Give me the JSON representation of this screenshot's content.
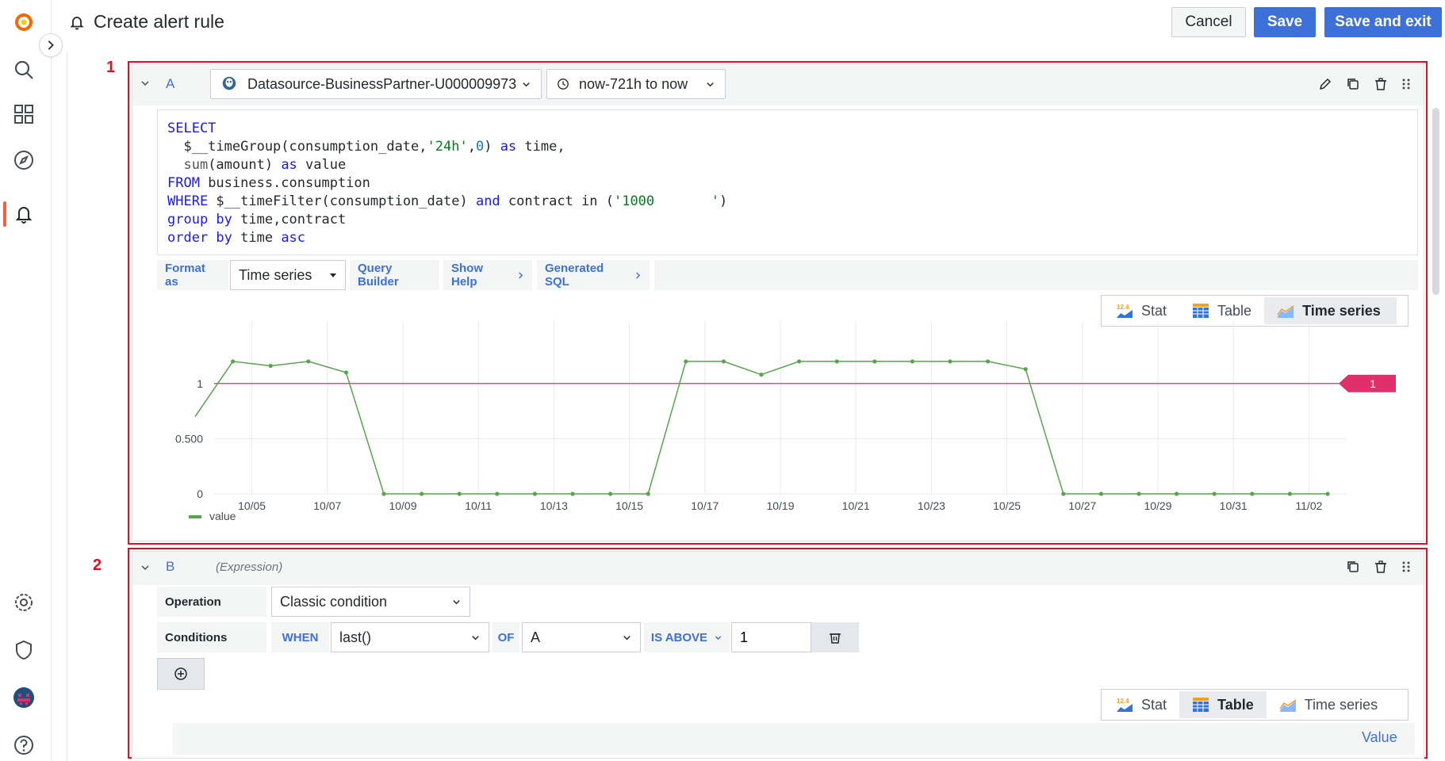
{
  "page": {
    "title": "Create alert rule"
  },
  "actions": {
    "cancel": "Cancel",
    "save": "Save",
    "save_exit": "Save and exit"
  },
  "markers": {
    "one": "1",
    "two": "2"
  },
  "query_a": {
    "ref_id": "A",
    "datasource": "Datasource-BusinessPartner-U000009973",
    "time_range": "now-721h to now",
    "sql": {
      "l1": "SELECT",
      "l2a": "  $__timeGroup(consumption_date,",
      "l2b": "'24h'",
      "l2c": ",",
      "l2d": "0",
      "l2e": ") ",
      "l2f": "as",
      "l2g": " time,",
      "l3a": "  sum",
      "l3b": "(amount) ",
      "l3c": "as",
      "l3d": " value",
      "l4a": "FROM",
      "l4b": " business.consumption",
      "l5a": "WHERE",
      "l5b": " $__timeFilter(consumption_date) ",
      "l5c": "and",
      "l5d": " contract in (",
      "l5e": "'1000       '",
      "l5f": ")",
      "l6a": "group by",
      "l6b": " time,contract",
      "l7a": "order by",
      "l7b": " time ",
      "l7c": "asc"
    },
    "toolbar": {
      "format_as_label": "Format as",
      "format_value": "Time series",
      "query_builder": "Query Builder",
      "show_help": "Show Help",
      "generated_sql": "Generated SQL"
    },
    "viz": {
      "stat": "Stat",
      "table": "Table",
      "time_series": "Time series",
      "selected": "Time series"
    }
  },
  "chart_data": {
    "type": "line",
    "title": "",
    "xlabel": "",
    "ylabel": "",
    "x": [
      "10/04",
      "10/05",
      "10/06",
      "10/07",
      "10/08",
      "10/09",
      "10/10",
      "10/11",
      "10/12",
      "10/13",
      "10/14",
      "10/15",
      "10/16",
      "10/17",
      "10/18",
      "10/19",
      "10/20",
      "10/21",
      "10/22",
      "10/23",
      "10/24",
      "10/25",
      "10/26",
      "10/27",
      "10/28",
      "10/29",
      "10/30",
      "10/31",
      "11/01",
      "11/02",
      "11/03"
    ],
    "x_ticks": [
      "10/05",
      "10/07",
      "10/09",
      "10/11",
      "10/13",
      "10/15",
      "10/17",
      "10/19",
      "10/21",
      "10/23",
      "10/25",
      "10/27",
      "10/29",
      "10/31",
      "11/02"
    ],
    "y_ticks": [
      "0",
      "0.500",
      "1"
    ],
    "ylim": [
      0,
      1.3
    ],
    "series": [
      {
        "name": "value",
        "color": "#56a64b",
        "values": [
          0.7,
          1.2,
          1.16,
          1.2,
          1.1,
          0,
          0,
          0,
          0,
          0,
          0,
          0,
          0,
          1.2,
          1.2,
          1.08,
          1.2,
          1.2,
          1.2,
          1.2,
          1.2,
          1.2,
          1.13,
          0,
          0,
          0,
          0,
          0,
          0,
          0,
          0
        ]
      }
    ],
    "threshold": {
      "value": 1,
      "label": "1",
      "color": "#e02f6b"
    },
    "legend": "bottom-left",
    "grid": true
  },
  "query_b": {
    "ref_id": "B",
    "type_label": "(Expression)",
    "operation_label": "Operation",
    "operation_value": "Classic condition",
    "conditions_label": "Conditions",
    "when": "WHEN",
    "reducer": "last()",
    "of": "OF",
    "query_ref": "A",
    "evaluator": "IS ABOVE",
    "threshold": "1",
    "viz": {
      "stat": "Stat",
      "table": "Table",
      "time_series": "Time series",
      "selected": "Table"
    },
    "table_header": "Value"
  },
  "icons": {
    "nav": [
      "grafana-logo-icon",
      "search-icon",
      "dashboards-icon",
      "explore-icon",
      "alerting-icon",
      "settings-icon",
      "shield-icon",
      "avatar",
      "help-icon"
    ]
  }
}
